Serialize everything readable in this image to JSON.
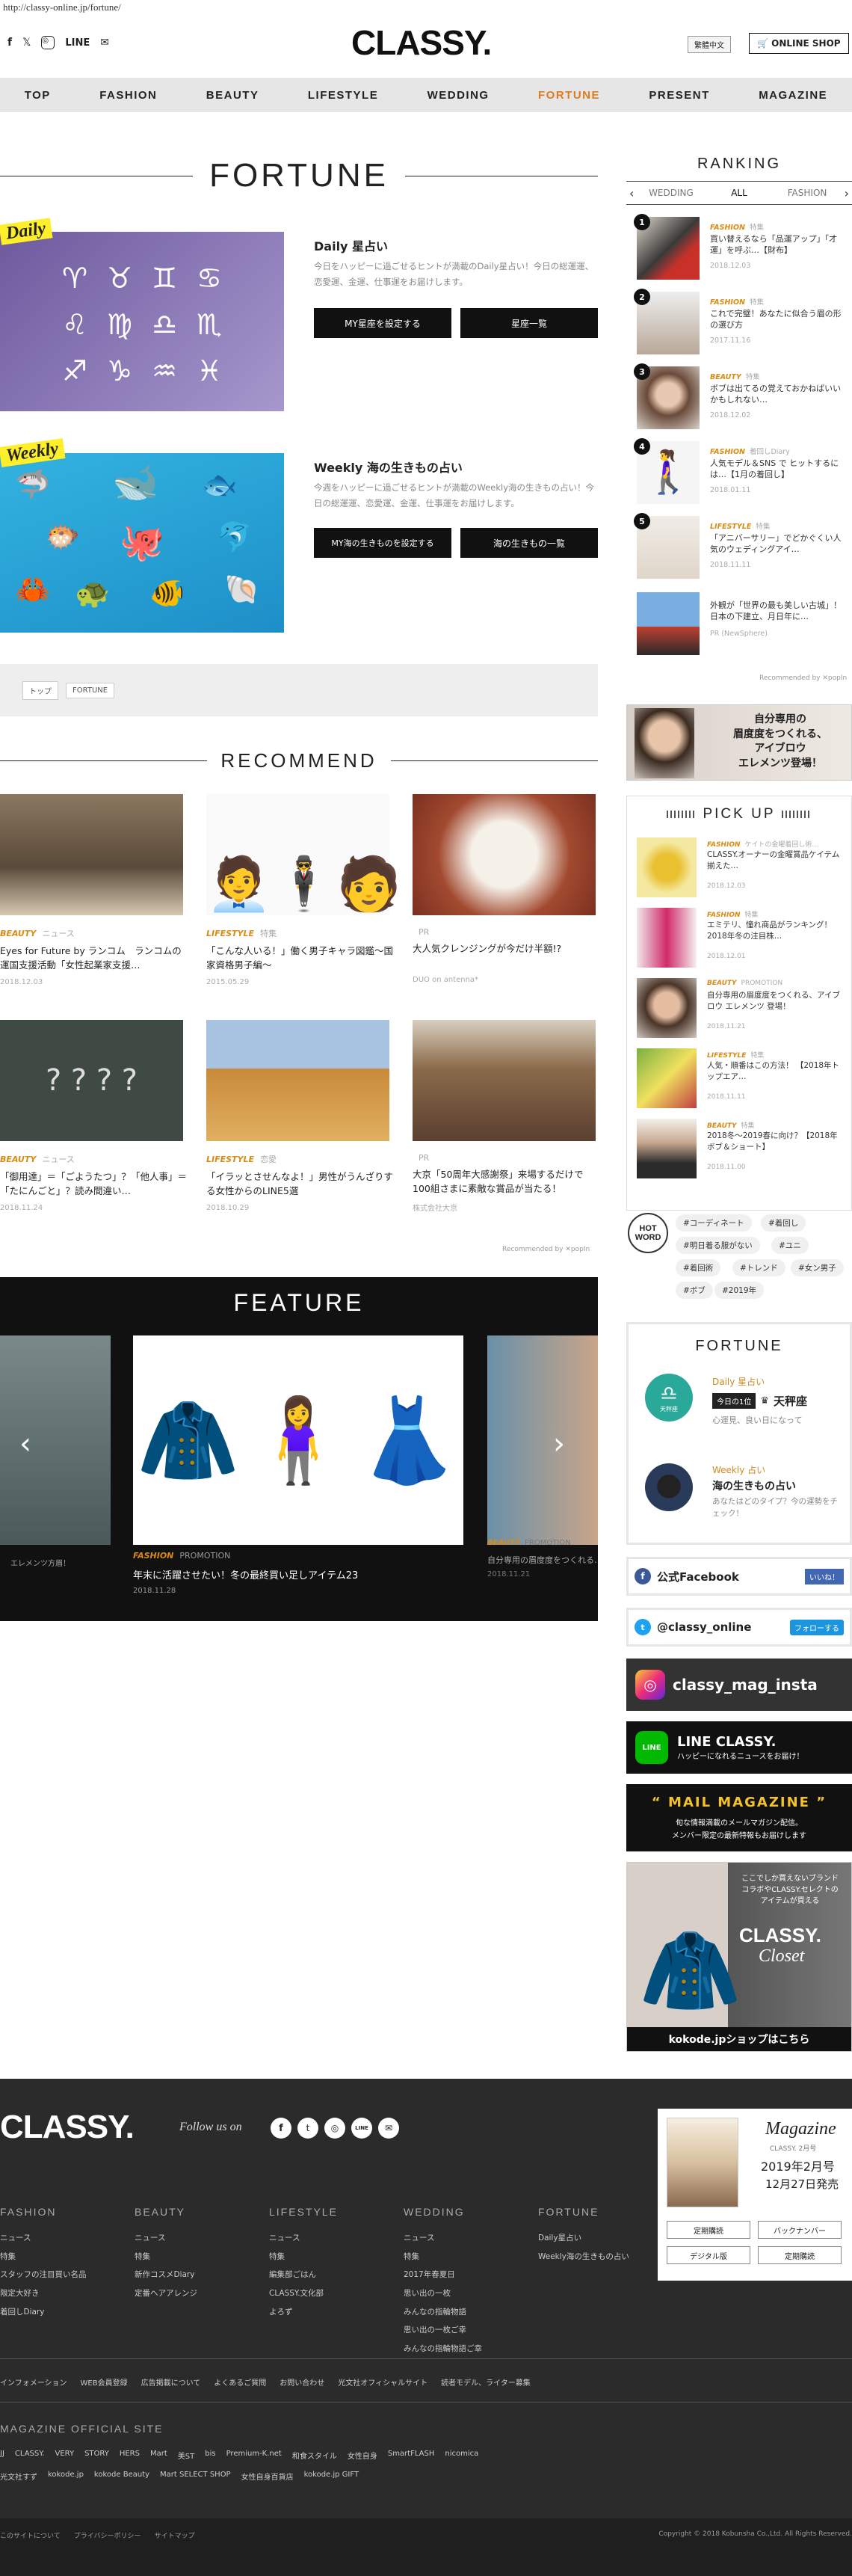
{
  "browser": {
    "url": "http://classy-online.jp/fortune/"
  },
  "header": {
    "logo": "CLASSY.",
    "sns": [
      "f",
      "𝕏",
      "◎",
      "LINE",
      "✉"
    ],
    "lang_label": "繁體中文",
    "shop_label": "ONLINE SHOP",
    "nav": [
      {
        "label": "TOP"
      },
      {
        "label": "FASHION"
      },
      {
        "label": "BEAUTY"
      },
      {
        "label": "LIFESTYLE"
      },
      {
        "label": "WEDDING"
      },
      {
        "label": "FORTUNE"
      },
      {
        "label": "PRESENT"
      },
      {
        "label": "MAGAZINE"
      }
    ],
    "active_nav": "FORTUNE",
    "accent_color": "#e07a1c"
  },
  "fortune": {
    "heading": "FORTUNE",
    "daily": {
      "badge": "Daily",
      "title": "Daily 星占い",
      "desc": "今日をハッピーに過ごせるヒントが満載のDaily星占い！今日の総運運、恋愛運、金運、仕事運をお届けします。",
      "btn_set": "MY星座を設定する",
      "btn_list": "星座一覧",
      "zodiac": [
        "♈",
        "♉",
        "♊",
        "♋",
        "♌",
        "♍",
        "♎",
        "♏",
        "♐",
        "♑",
        "♒",
        "♓"
      ]
    },
    "weekly": {
      "badge": "Weekly",
      "title": "Weekly 海の生きもの占い",
      "desc": "今週をハッピーに過ごせるヒントが満載のWeekly海の生きもの占い！今日の総運運、恋愛運、金運、仕事運をお届けします。",
      "btn_set": "MY海の生きものを設定する",
      "btn_list": "海の生きもの一覧"
    },
    "breadcrumb": [
      "トップ",
      "FORTUNE"
    ]
  },
  "recommend": {
    "heading": "RECOMMEND",
    "cards": [
      {
        "cat": "BEAUTY",
        "sub": "ニュース",
        "title": "Eyes for Future by ランコム　ランコムの運国支援活動「女性起業家支援…",
        "date": "2018.12.03"
      },
      {
        "cat": "LIFESTYLE",
        "sub": "特集",
        "title": "「こんな人いる！」働く男子キャラ図鑑〜国家資格男子編〜",
        "date": "2015.05.29"
      },
      {
        "cat": "",
        "sub": "PR",
        "title": "大人気クレンジングが今だけ半額!?",
        "date": "DUO on antenna*"
      },
      {
        "cat": "BEAUTY",
        "sub": "ニュース",
        "title": "「御用達」＝「ごようたつ」？「他人事」＝「たにんごと」？読み間違い…",
        "date": "2018.11.24"
      },
      {
        "cat": "LIFESTYLE",
        "sub": "恋愛",
        "title": "「イラッとさせんなよ！」男性がうんざりする女性からのLINE5選",
        "date": "2018.10.29"
      },
      {
        "cat": "",
        "sub": "PR",
        "title": "大京「50周年大感謝祭」来場するだけで100組さまに素敵な賞品が当たる！",
        "date": "株式会社大京"
      }
    ],
    "rec_by": "Recommended by ✕popIn"
  },
  "feature": {
    "heading": "FEATURE",
    "left_caption": "エレメンツ方眉！",
    "main": {
      "cat": "FASHION",
      "sub": "PROMOTION",
      "title": "年末に活躍させたい！冬の最終買い足しアイテム23",
      "date": "2018.11.28"
    },
    "right": {
      "cat": "BEAUTY",
      "sub": "PROMOTION",
      "title": "自分専用の眉度度をつくれる…",
      "date": "2018.11.21"
    }
  },
  "ranking": {
    "heading": "RANKING",
    "tabs": [
      "WEDDING",
      "ALL",
      "FASHION"
    ],
    "items": [
      {
        "rank": "1",
        "cat": "FASHION",
        "sub": "特集",
        "title": "買い替えるなら「品運アップ」「才運」を呼ぶ…【財布】",
        "date": "2018.12.03"
      },
      {
        "rank": "2",
        "cat": "FASHION",
        "sub": "特集",
        "title": "これで完璧！あなたに似合う眉の形の選び方",
        "date": "2017.11.16"
      },
      {
        "rank": "3",
        "cat": "BEAUTY",
        "sub": "特集",
        "title": "ボブは出てるの覚えておかねばいいかもしれない…",
        "date": "2018.12.02"
      },
      {
        "rank": "4",
        "cat": "FASHION",
        "sub": "着回しDiary",
        "title": "人気モデル＆SNS で ヒットするには…【1月の着回し】",
        "date": "2018.01.11"
      },
      {
        "rank": "5",
        "cat": "LIFESTYLE",
        "sub": "特集",
        "title": "「アニバーサリー」でどかぐくい人気のウェディングアイ…",
        "date": "2018.11.11"
      },
      {
        "rank": "",
        "cat": "",
        "sub": "",
        "title": "外観が「世界の最も美しい古城」！日本の下建立、月日年に…",
        "date": "PR (NewSphere)"
      }
    ],
    "rec_by": "Recommended by ✕popIn"
  },
  "side_banner": {
    "line1": "自分専用の",
    "line2": "眉度度をつくれる、",
    "line3": "アイブロウ",
    "line4": "エレメンツ登場！"
  },
  "pickup": {
    "heading": "PICK UP",
    "items": [
      {
        "cat": "FASHION",
        "sub": "ケイトの金曜着回し術…",
        "title": "CLASSY.オーナーの金曜賞品ケイテム揃えた…",
        "date": "2018.12.03"
      },
      {
        "cat": "FASHION",
        "sub": "特集",
        "title": "エミテリ、憧れ商品がランキング！2018年冬の注目株…",
        "date": "2018.12.01"
      },
      {
        "cat": "BEAUTY",
        "sub": "PROMOTION",
        "title": "自分専用の眉度度をつくれる、アイブロウ エレメンツ 登場！",
        "date": "2018.11.21"
      },
      {
        "cat": "LIFESTYLE",
        "sub": "特集",
        "title": "人気・順番はこの方法！ 【2018年トップエア…",
        "date": "2018.11.11"
      },
      {
        "cat": "BEAUTY",
        "sub": "特集",
        "title": "2018冬〜2019春に向け？【2018年ボブ＆ショート】",
        "date": "2018.11.00"
      }
    ]
  },
  "hotword": {
    "label": "HOT WORD",
    "tags": [
      "#コーディネート",
      "#着回し",
      "#明日着る服がない",
      "#ユニ",
      "#着回術",
      "#トレンド",
      "#女ン男子",
      "#ボブ",
      "#2019年"
    ]
  },
  "fortune_widget": {
    "heading": "FORTUNE",
    "daily_label": "Daily 星占い",
    "today_badge": "今日の1位",
    "today_sign": "天秤座",
    "today_desc": "心運見、良い日になって",
    "sign_icon_label": "天秤座",
    "weekly_label": "Weekly 占い",
    "weekly_title": "海の生きもの占い",
    "weekly_desc": "あなたはどのタイプ？今の運勢をチェック！"
  },
  "sns": {
    "facebook_label": "公式Facebook",
    "facebook_btn": "いいね！",
    "twitter_label": "@classy_online",
    "twitter_btn": "フォローする",
    "instagram_label": "classy_mag_insta",
    "line_title": "LINE CLASSY.",
    "line_sub": "ハッピーになれるニュースをお届け！",
    "mail_title": "MAIL MAGAZINE",
    "mail_sub1": "旬な情報満載のメールマガジン配信。",
    "mail_sub2": "メンバー限定の最新特報もお届けします",
    "closet_copy1": "ここでしか買えないブランド",
    "closet_copy2": "コラボやCLASSY.セレクトの",
    "closet_copy3": "アイテムが買える",
    "closet_logo": "CLASSY.",
    "closet_sub": "Closet",
    "closet_link": "kokode.jpショップはこちら"
  },
  "footer": {
    "logo": "CLASSY.",
    "follow": "Follow us on",
    "cols": [
      {
        "title": "FASHION",
        "items": [
          "ニュース",
          "特集",
          "スタッフの注目買い名品",
          "限定大好き",
          "着回しDiary"
        ]
      },
      {
        "title": "BEAUTY",
        "items": [
          "ニュース",
          "特集",
          "新作コスメDiary",
          "定番ヘアアレンジ"
        ]
      },
      {
        "title": "LIFESTYLE",
        "items": [
          "ニュース",
          "特集",
          "編集部ごはん",
          "CLASSY.文化部",
          "よろず"
        ]
      },
      {
        "title": "WEDDING",
        "items": [
          "ニュース",
          "特集",
          "2017年春夏日",
          "思い出の一枚",
          "みんなの指輪物語",
          "思い出の一枚ご幸",
          "みんなの指輪物語ご幸"
        ]
      },
      {
        "title": "FORTUNE",
        "items": [
          "Daily星占い",
          "Weekly海の生きもの占い"
        ]
      }
    ],
    "magazine": {
      "title": "Magazine",
      "sub": "CLASSY. 2月号",
      "issue": "2019年2月号",
      "release": "12月27日発売",
      "btns": [
        "定期購読",
        "バックナンバー",
        "デジタル版",
        "定期購読"
      ]
    },
    "info_links": [
      "インフォメーション",
      "WEB会員登録",
      "広告掲載について",
      "よくあるご質問",
      "お問い合わせ",
      "光文社オフィシャルサイト",
      "読者モデル、ライター募集"
    ],
    "official_heading": "MAGAZINE OFFICIAL SITE",
    "official_row1": [
      "JJ",
      "CLASSY.",
      "VERY",
      "STORY",
      "HERS",
      "Mart",
      "美ST",
      "bis",
      "Premium-K.net",
      "和食スタイル",
      "女性自身",
      "SmartFLASH",
      "nicomica"
    ],
    "official_row2": [
      "光文社すず",
      "kokode.jp",
      "kokode Beauty",
      "Mart SELECT SHOP",
      "女性自身百貨店",
      "kokode.jp GIFT"
    ],
    "bottom_links": [
      "このサイトについて",
      "プライバシーポリシー",
      "サイトマップ"
    ],
    "copyright": "Copyright © 2018 Kobunsha Co.,Ltd. All Rights Reserved."
  }
}
